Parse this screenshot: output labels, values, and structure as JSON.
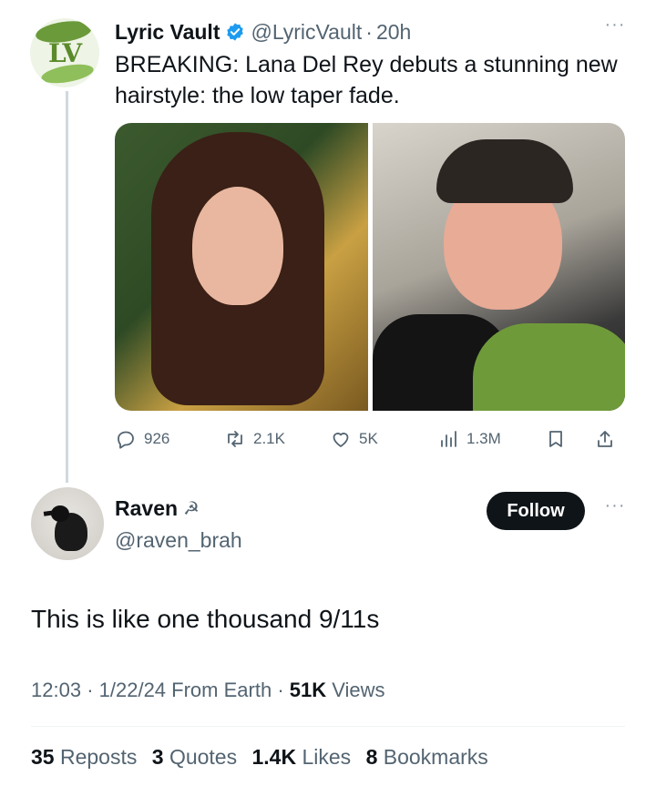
{
  "tweet": {
    "author_name": "Lyric Vault",
    "avatar_initials": "LV",
    "handle": "@LyricVault",
    "separator": "·",
    "time": "20h",
    "more_label": "···",
    "text": "BREAKING: Lana Del Rey debuts a stunning new hairstyle: the low taper fade.",
    "media": [
      {
        "name": "photo-left",
        "kind": "photo"
      },
      {
        "name": "photo-right",
        "kind": "photo"
      }
    ],
    "actions": {
      "replies": "926",
      "reposts": "2.1K",
      "likes": "5K",
      "views": "1.3M"
    }
  },
  "reply": {
    "author_name": "Raven",
    "name_symbol": "☭",
    "handle": "@raven_brah",
    "follow_label": "Follow",
    "more_label": "···",
    "text": "This is like one thousand 9/11s",
    "meta": {
      "time": "12:03",
      "date": "1/22/24",
      "source": "From Earth",
      "views_count": "51K",
      "views_label": "Views",
      "sep": "·"
    },
    "stats": {
      "reposts_count": "35",
      "reposts_label": "Reposts",
      "quotes_count": "3",
      "quotes_label": "Quotes",
      "likes_count": "1.4K",
      "likes_label": "Likes",
      "bookmarks_count": "8",
      "bookmarks_label": "Bookmarks"
    }
  },
  "colors": {
    "text": "#0f1419",
    "secondary": "#536471",
    "verified": "#1d9bf0",
    "thread_line": "#cfd9de"
  }
}
